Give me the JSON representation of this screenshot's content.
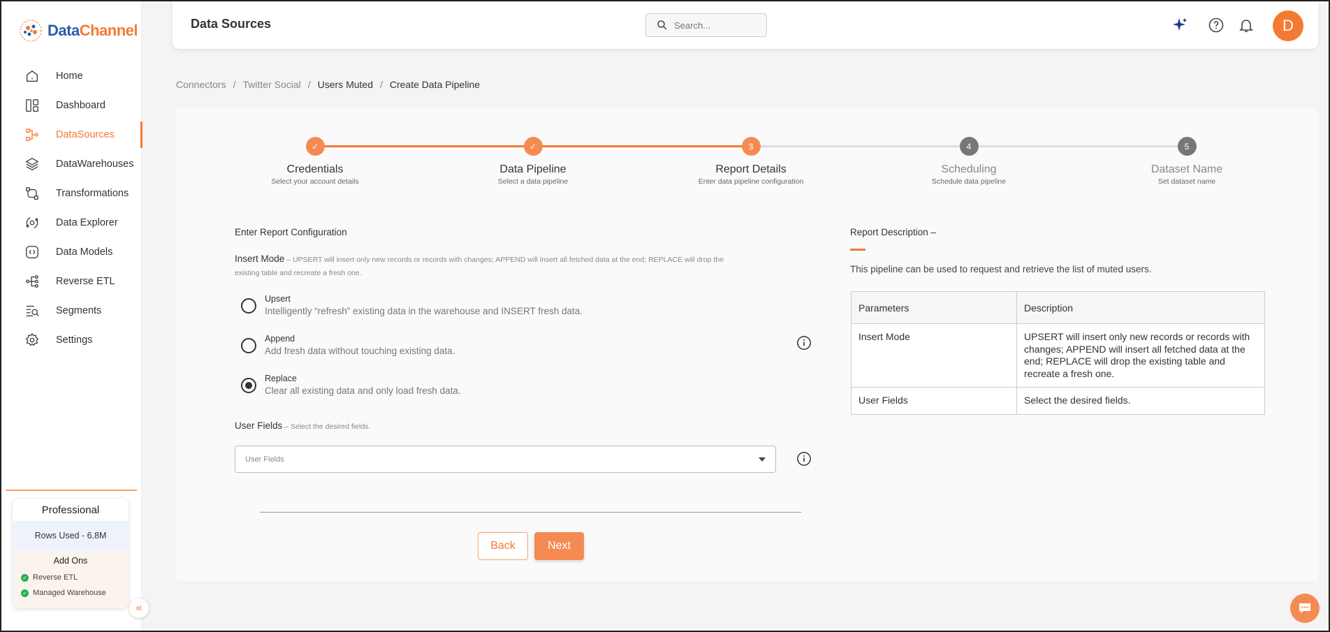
{
  "brand": {
    "name_part1": "Data",
    "name_part2": "Channel"
  },
  "sidebar": {
    "items": [
      {
        "label": "Home",
        "icon": "home-icon",
        "active": false
      },
      {
        "label": "Dashboard",
        "icon": "dashboard-icon",
        "active": false
      },
      {
        "label": "DataSources",
        "icon": "datasources-icon",
        "active": true
      },
      {
        "label": "DataWarehouses",
        "icon": "layers-icon",
        "active": false
      },
      {
        "label": "Transformations",
        "icon": "transform-icon",
        "active": false
      },
      {
        "label": "Data Explorer",
        "icon": "explorer-icon",
        "active": false
      },
      {
        "label": "Data Models",
        "icon": "models-icon",
        "active": false
      },
      {
        "label": "Reverse ETL",
        "icon": "reverse-etl-icon",
        "active": false
      },
      {
        "label": "Segments",
        "icon": "segments-icon",
        "active": false
      },
      {
        "label": "Settings",
        "icon": "gear-icon",
        "active": false
      }
    ],
    "plan": {
      "name": "Professional",
      "rows_used": "Rows Used - 6.8M",
      "addons_title": "Add Ons",
      "addons": [
        "Reverse ETL",
        "Managed Warehouse"
      ]
    },
    "collapse_icon": "«"
  },
  "header": {
    "title": "Data Sources",
    "search_placeholder": "Search...",
    "avatar_initial": "D"
  },
  "breadcrumb": [
    "Connectors",
    "Twitter Social",
    "Users Muted",
    "Create Data Pipeline"
  ],
  "stepper": {
    "steps": [
      {
        "number": "1",
        "title": "Credentials",
        "subtitle": "Select your account details",
        "status": "done"
      },
      {
        "number": "2",
        "title": "Data Pipeline",
        "subtitle": "Select a data pipeline",
        "status": "done"
      },
      {
        "number": "3",
        "title": "Report Details",
        "subtitle": "Enter data pipeline configuration",
        "status": "current"
      },
      {
        "number": "4",
        "title": "Scheduling",
        "subtitle": "Schedule data pipeline",
        "status": "pending"
      },
      {
        "number": "5",
        "title": "Dataset Name",
        "subtitle": "Set dataset name",
        "status": "pending"
      }
    ]
  },
  "form": {
    "heading": "Enter Report Configuration",
    "insert_mode": {
      "label": "Insert Mode",
      "hint": " – UPSERT will insert only new records or records with changes; APPEND will insert all fetched data at the end; REPLACE will drop the existing table and recreate a fresh one.",
      "options": [
        {
          "title": "Upsert",
          "desc": "Intelligently “refresh” existing data in the warehouse and INSERT fresh data.",
          "selected": false
        },
        {
          "title": "Append",
          "desc": "Add fresh data without touching existing data.",
          "selected": false
        },
        {
          "title": "Replace",
          "desc": "Clear all existing data and only load fresh data.",
          "selected": true
        }
      ]
    },
    "user_fields": {
      "label": "User Fields",
      "hint": " – Select the desired fields.",
      "placeholder": "User Fields"
    },
    "back_label": "Back",
    "next_label": "Next"
  },
  "description": {
    "title": "Report Description –",
    "text": "This pipeline can be used to request and retrieve the list of muted users.",
    "table_headers": [
      "Parameters",
      "Description"
    ],
    "table_rows": [
      [
        "Insert Mode",
        "UPSERT will insert only new records or records with changes; APPEND will insert all fetched data at the end; REPLACE will drop the existing table and recreate a fresh one."
      ],
      [
        "User Fields",
        "Select the desired fields."
      ]
    ]
  },
  "colors": {
    "accent": "#f47a33",
    "pending": "#777777",
    "track": "#dddddd"
  }
}
